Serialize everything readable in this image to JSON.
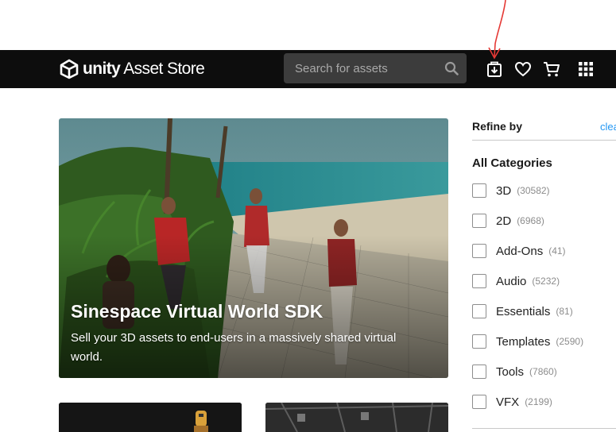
{
  "header": {
    "logo_brand": "unity",
    "logo_product": "Asset Store",
    "search": {
      "placeholder": "Search for assets"
    },
    "icons": [
      "unity-logo-icon",
      "search-icon",
      "downloads-icon",
      "wishlist-heart-icon",
      "cart-icon",
      "apps-grid-icon"
    ]
  },
  "hero": {
    "title": "Sinespace Virtual World SDK",
    "subtitle": "Sell your 3D assets to end-users in a massively shared virtual world."
  },
  "sidebar": {
    "refine_label": "Refine by",
    "clear_label": "clear",
    "categories_heading": "All Categories",
    "categories": [
      {
        "name": "3D",
        "count": "(30582)"
      },
      {
        "name": "2D",
        "count": "(6968)"
      },
      {
        "name": "Add-Ons",
        "count": "(41)"
      },
      {
        "name": "Audio",
        "count": "(5232)"
      },
      {
        "name": "Essentials",
        "count": "(81)"
      },
      {
        "name": "Templates",
        "count": "(2590)"
      },
      {
        "name": "Tools",
        "count": "(7860)"
      },
      {
        "name": "VFX",
        "count": "(2199)"
      }
    ]
  },
  "colors": {
    "topbar": "#0d0d0d",
    "search_bg": "#3c3c3c",
    "link": "#2196f3",
    "annotation": "#e53935"
  }
}
